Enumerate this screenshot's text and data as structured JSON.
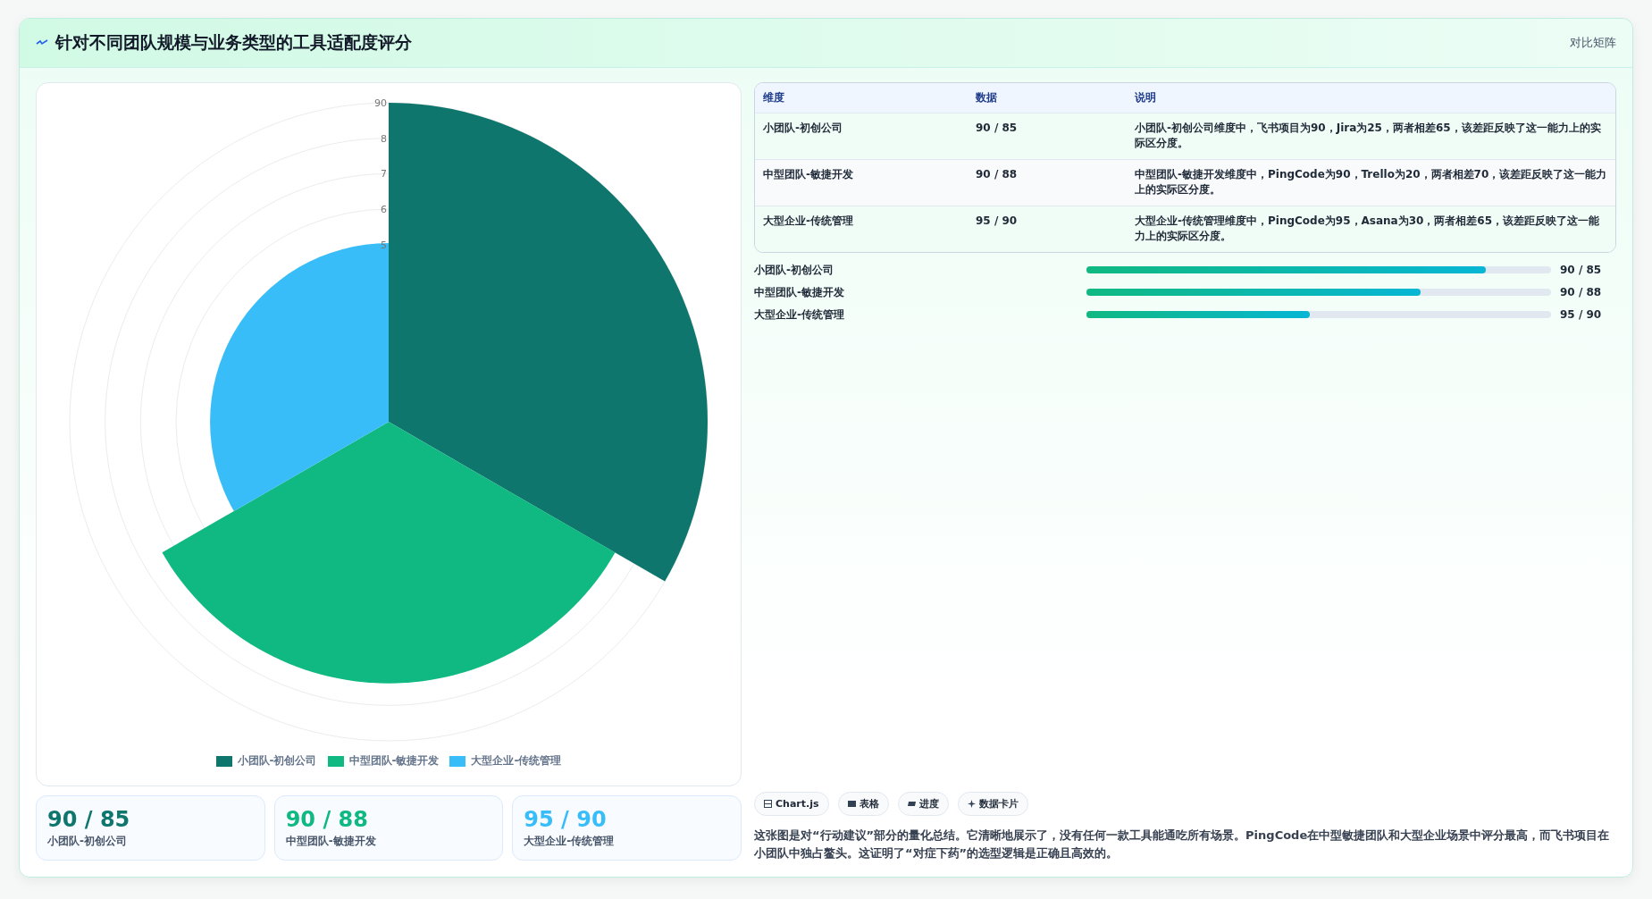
{
  "header": {
    "title": "针对不同团队规模与业务类型的工具适配度评分",
    "tag": "对比矩阵"
  },
  "chart": {
    "axis_labels": [
      "90",
      "8",
      "7",
      "6",
      "5"
    ],
    "legend": [
      {
        "label": "小团队-初创公司",
        "color": "#0f766e"
      },
      {
        "label": "中型团队-敏捷开发",
        "color": "#10b981"
      },
      {
        "label": "大型企业-传统管理",
        "color": "#38bdf8"
      }
    ]
  },
  "cards": [
    {
      "value": "90 / 85",
      "label": "小团队-初创公司",
      "color": "#0f766e"
    },
    {
      "value": "90 / 88",
      "label": "中型团队-敏捷开发",
      "color": "#10b981"
    },
    {
      "value": "95 / 90",
      "label": "大型企业-传统管理",
      "color": "#38bdf8"
    }
  ],
  "table": {
    "columns": [
      "维度",
      "数据",
      "说明"
    ],
    "rows": [
      [
        "小团队-初创公司",
        "90 / 85",
        "小团队-初创公司维度中，飞书项目为90，Jira为25，两者相差65，该差距反映了这一能力上的实际区分度。"
      ],
      [
        "中型团队-敏捷开发",
        "90 / 88",
        "中型团队-敏捷开发维度中，PingCode为90，Trello为20，两者相差70，该差距反映了这一能力上的实际区分度。"
      ],
      [
        "大型企业-传统管理",
        "95 / 90",
        "大型企业-传统管理维度中，PingCode为95，Asana为30，两者相差65，该差距反映了这一能力上的实际区分度。"
      ]
    ]
  },
  "progress": [
    {
      "label": "小团队-初创公司",
      "level": 0.86,
      "reading": "90 / 85"
    },
    {
      "label": "中型团队-敏捷开发",
      "level": 0.72,
      "reading": "90 / 88"
    },
    {
      "label": "大型企业-传统管理",
      "level": 0.48,
      "reading": "95 / 90"
    }
  ],
  "chips": [
    {
      "kind": "chart",
      "label": "Chart.js"
    },
    {
      "kind": "table",
      "label": "表格"
    },
    {
      "kind": "progress",
      "label": "进度"
    },
    {
      "kind": "cards",
      "label": "数据卡片"
    }
  ],
  "summary": "这张图是对“行动建议”部分的量化总结。它清晰地展示了，没有任何一款工具能通吃所有场景。PingCode在中型敏捷团队和大型企业场景中评分最高，而飞书项目在小团队中独占鳌头。这证明了“对症下药”的选型逻辑是正确且高效的。"
}
